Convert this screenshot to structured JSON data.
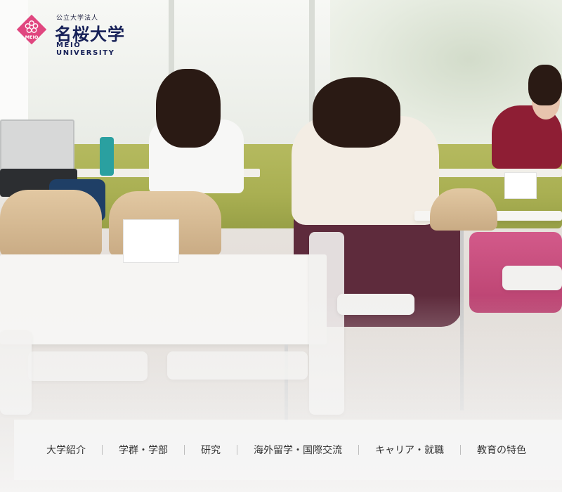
{
  "header": {
    "logo": {
      "subtitle": "公立大学法人",
      "name_ja": "名桜大学",
      "name_en": "MEIO UNIVERSITY",
      "mark_text": "MEIO",
      "mark_color": "#e0467f",
      "text_color": "#162057"
    }
  },
  "hero": {
    "image": "students-studying-in-lounge"
  },
  "nav": {
    "items": [
      {
        "label": "大学紹介"
      },
      {
        "label": "学群・学部"
      },
      {
        "label": "研究"
      },
      {
        "label": "海外留学・国際交流"
      },
      {
        "label": "キャリア・就職"
      },
      {
        "label": "教育の特色"
      }
    ]
  }
}
